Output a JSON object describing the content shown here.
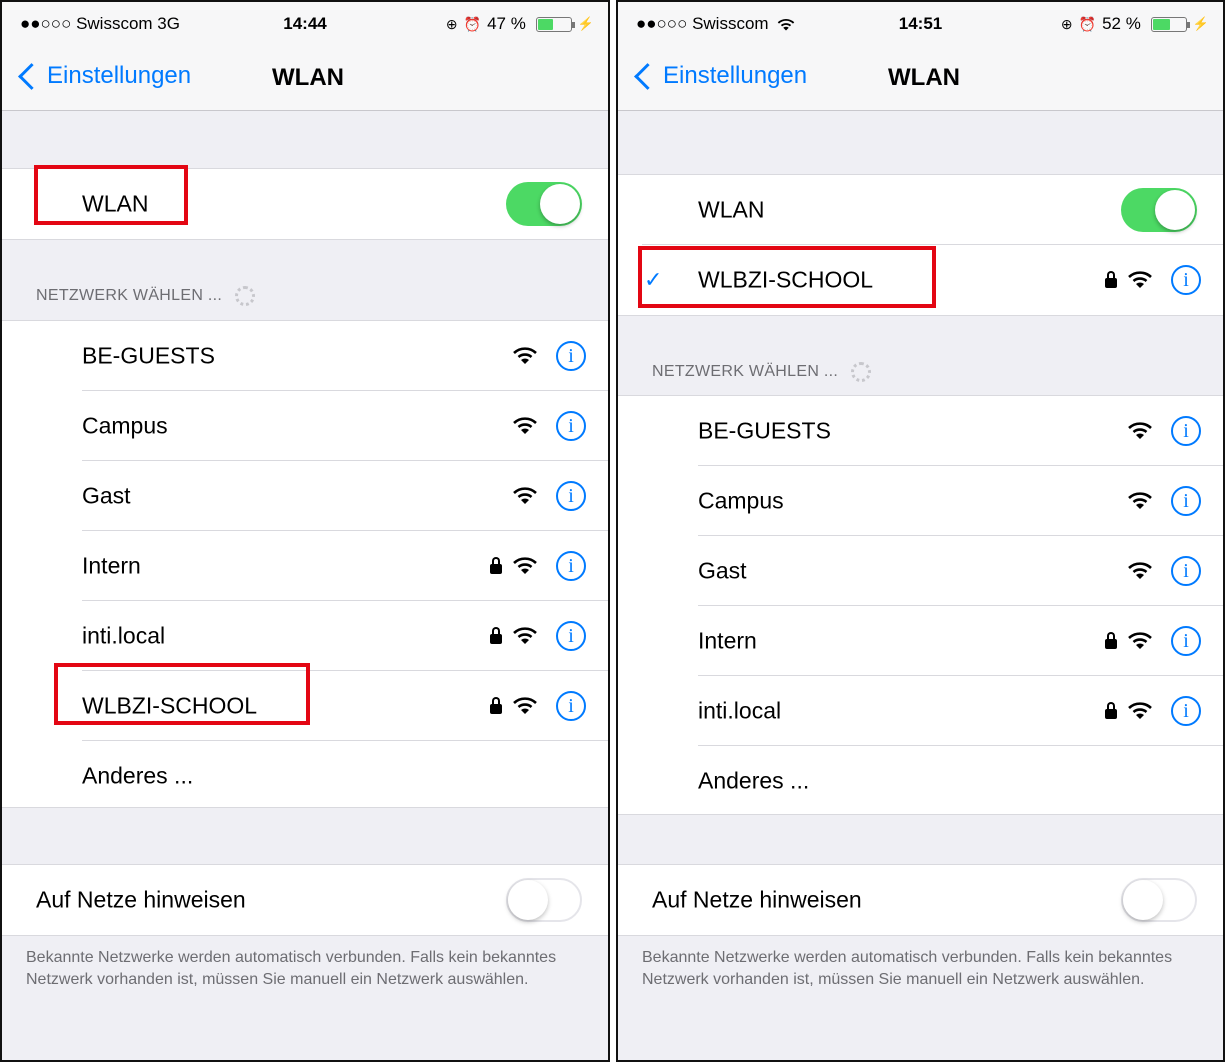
{
  "left": {
    "status": {
      "carrier": "●●○○○ Swisscom 3G",
      "time": "14:44",
      "battery_text": "47 %",
      "battery_level": 0.47
    },
    "nav": {
      "back_label": "Einstellungen",
      "title": "WLAN"
    },
    "wlan_label": "WLAN",
    "wlan_on": true,
    "networks_header": "NETZWERK WÄHLEN ...",
    "networks": [
      {
        "name": "BE-GUESTS",
        "locked": false
      },
      {
        "name": "Campus",
        "locked": false
      },
      {
        "name": "Gast",
        "locked": false
      },
      {
        "name": "Intern",
        "locked": true
      },
      {
        "name": "inti.local",
        "locked": true
      },
      {
        "name": "WLBZI-SCHOOL",
        "locked": true
      }
    ],
    "other_label": "Anderes ...",
    "ask_label": "Auf Netze hinweisen",
    "ask_on": false,
    "footer": "Bekannte Netzwerke werden automatisch verbunden. Falls kein bekanntes Netzwerk vorhanden ist, müssen Sie manuell ein Netzwerk auswählen."
  },
  "right": {
    "status": {
      "carrier": "●●○○○ Swisscom",
      "time": "14:51",
      "battery_text": "52 %",
      "battery_level": 0.52
    },
    "nav": {
      "back_label": "Einstellungen",
      "title": "WLAN"
    },
    "wlan_label": "WLAN",
    "wlan_on": true,
    "connected_network": "WLBZI-SCHOOL",
    "networks_header": "NETZWERK WÄHLEN ...",
    "networks": [
      {
        "name": "BE-GUESTS",
        "locked": false
      },
      {
        "name": "Campus",
        "locked": false
      },
      {
        "name": "Gast",
        "locked": false
      },
      {
        "name": "Intern",
        "locked": true
      },
      {
        "name": "inti.local",
        "locked": true
      }
    ],
    "other_label": "Anderes ...",
    "ask_label": "Auf Netze hinweisen",
    "ask_on": false,
    "footer": "Bekannte Netzwerke werden automatisch verbunden. Falls kein bekanntes Netzwerk vorhanden ist, müssen Sie manuell ein Netzwerk auswählen."
  },
  "colors": {
    "accent": "#007aff",
    "toggle_on": "#4cd964",
    "highlight": "#e30613"
  },
  "icons": {
    "wifi": "wifi-icon",
    "lock": "lock-icon",
    "info": "info-icon",
    "check": "checkmark-icon"
  }
}
